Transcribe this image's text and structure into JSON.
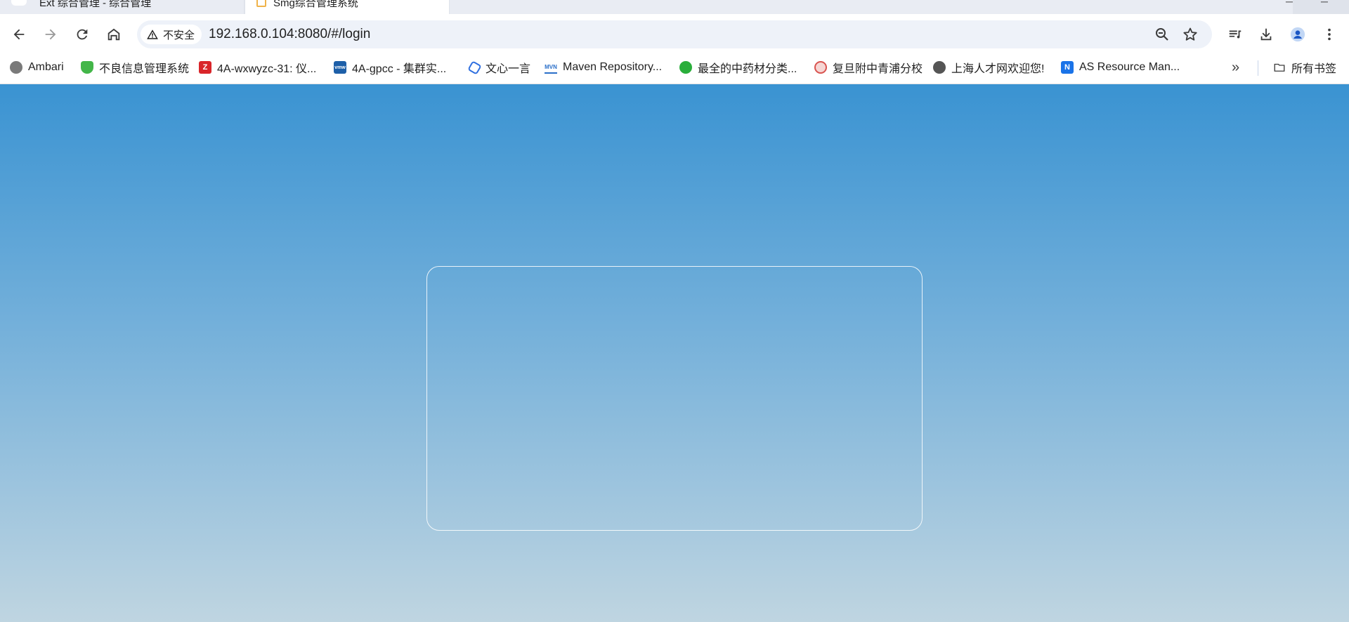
{
  "browser": {
    "tabs": [
      {
        "title": "Ext 综合管理 - 综合管理",
        "active": false
      },
      {
        "title": "Smg综合管理系统",
        "active": true
      }
    ],
    "security_label": "不安全",
    "url": "192.168.0.104:8080/#/login"
  },
  "bookmarks": [
    {
      "label": "Ambari",
      "icon": "ambari-icon",
      "color": "#6b6b6b"
    },
    {
      "label": "不良信息管理系统",
      "icon": "shield-icon",
      "color": "#43b649"
    },
    {
      "label": "4A-wxwyzc-31: 仪...",
      "icon": "z-icon",
      "color": "#d9252a"
    },
    {
      "label": "4A-gpcc - 集群实...",
      "icon": "vmw-icon",
      "color": "#1d5fa8"
    },
    {
      "label": "文心一言",
      "icon": "cube-icon",
      "color": "#2f6fe0"
    },
    {
      "label": "Maven Repository...",
      "icon": "mvn-icon",
      "color": "#2a6fc9"
    },
    {
      "label": "最全的中药材分类...",
      "icon": "wechat-icon",
      "color": "#2aae3b"
    },
    {
      "label": "复旦附中青浦分校",
      "icon": "school-seal-icon",
      "color": "#d9534f"
    },
    {
      "label": "上海人才网欢迎您!",
      "icon": "globe-icon",
      "color": "#555555"
    },
    {
      "label": "AS Resource Man...",
      "icon": "n-icon",
      "color": "#1a73e8"
    }
  ],
  "bookmarks_folder": "所有书签"
}
